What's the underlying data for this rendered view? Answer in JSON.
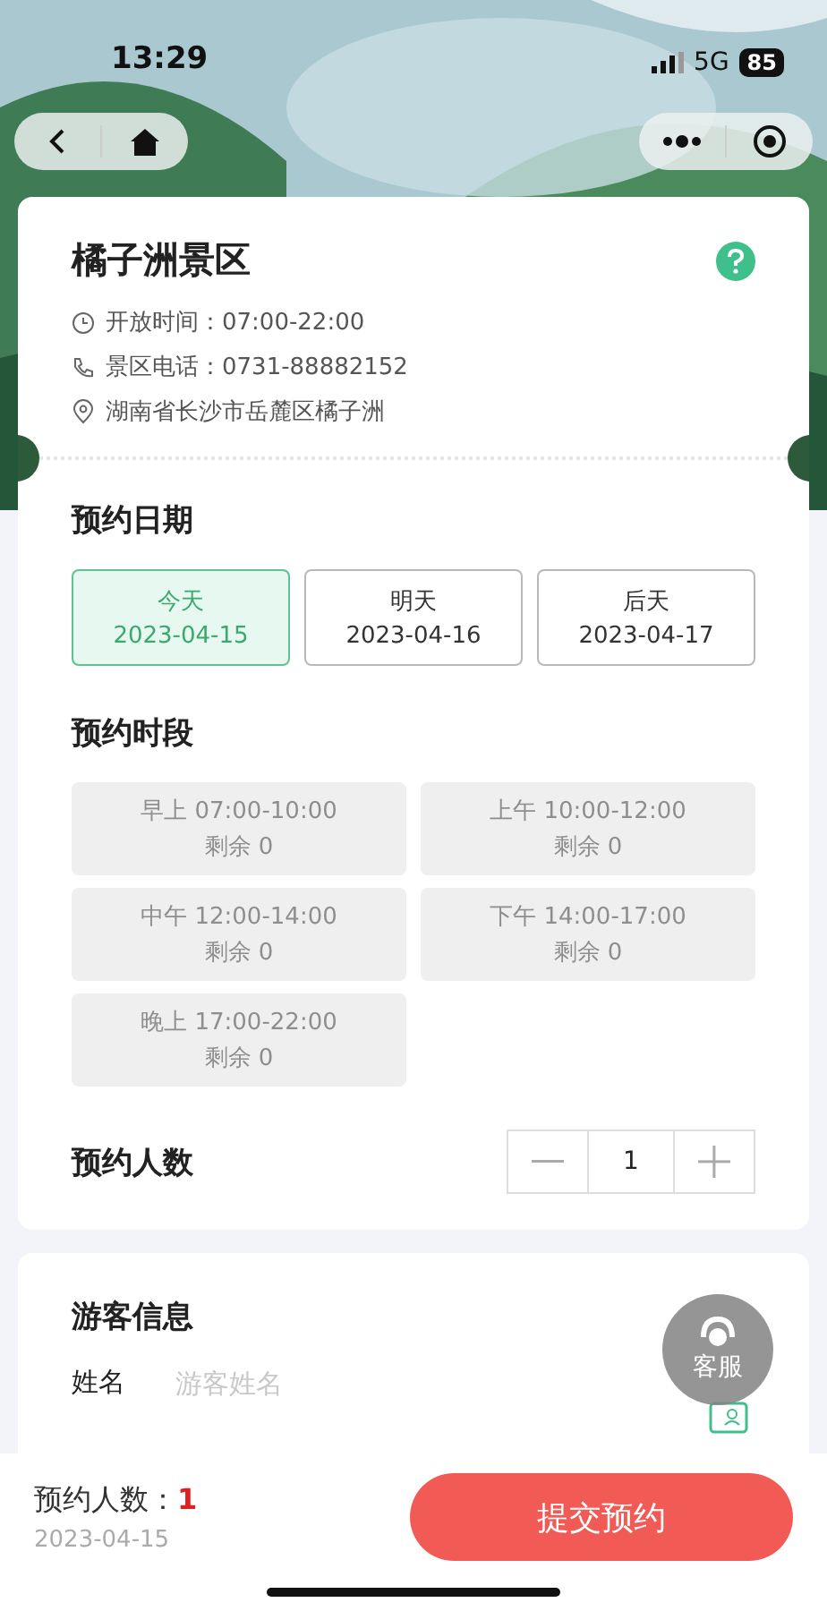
{
  "status_bar": {
    "time": "13:29",
    "network": "5G",
    "battery": "85"
  },
  "scenic": {
    "name": "橘子洲景区",
    "hours": "开放时间：07:00-22:00",
    "phone": "景区电话：0731-88882152",
    "address": "湖南省长沙市岳麓区橘子洲"
  },
  "date_section": {
    "title": "预约日期",
    "dates": [
      {
        "label": "今天",
        "date": "2023-04-15",
        "selected": true
      },
      {
        "label": "明天",
        "date": "2023-04-16",
        "selected": false
      },
      {
        "label": "后天",
        "date": "2023-04-17",
        "selected": false
      }
    ]
  },
  "slot_section": {
    "title": "预约时段",
    "slots": [
      {
        "time": "早上 07:00-10:00",
        "remaining": "剩余 0",
        "disabled": true
      },
      {
        "time": "上午 10:00-12:00",
        "remaining": "剩余 0",
        "disabled": true
      },
      {
        "time": "中午 12:00-14:00",
        "remaining": "剩余 0",
        "disabled": true
      },
      {
        "time": "下午 14:00-17:00",
        "remaining": "剩余 0",
        "disabled": true
      },
      {
        "time": "晚上 17:00-22:00",
        "remaining": "剩余 0",
        "disabled": true
      }
    ]
  },
  "count_section": {
    "title": "预约人数",
    "value": "1"
  },
  "visitor_section": {
    "title": "游客信息",
    "fields": [
      {
        "label": "姓名",
        "placeholder": "游客姓名"
      }
    ]
  },
  "service_button": {
    "label": "客服"
  },
  "footer": {
    "count_label": "预约人数：",
    "count": "1",
    "date": "2023-04-15",
    "submit": "提交预约"
  }
}
